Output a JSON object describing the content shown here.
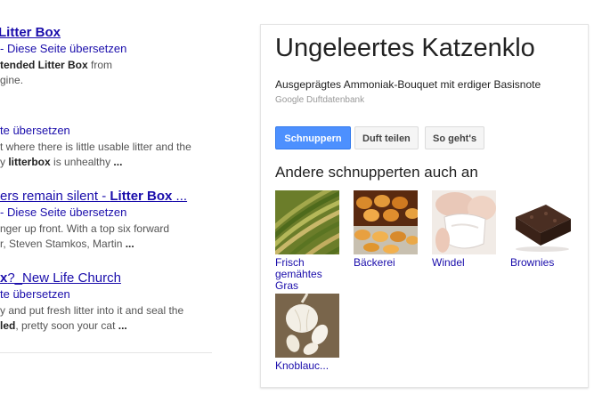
{
  "results": [
    {
      "title": "Litter Box",
      "subtitle": "- Diese Seite übersetzen",
      "snippet1_bold": "tended Litter Box",
      "snippet1_rest": " from",
      "snippet2": "gine."
    },
    {
      "subtitle": "te übersetzen",
      "snippet1": "t where there is little usable litter and the",
      "snippet2_pre": "y ",
      "snippet2_bold": "litterbox",
      "snippet2_rest": " is unhealthy ",
      "snippet2_end": "..."
    },
    {
      "title_pre": "ers remain silent - ",
      "title_bold": "Litter Box",
      "title_end": " ...",
      "subtitle": "- Diese Seite übersetzen",
      "snippet1": "nger up front. With a top six forward",
      "snippet2_pre": "r, Steven Stamkos, Martin ",
      "snippet2_end": "..."
    },
    {
      "title_bold": "x",
      "title_rest": "?_New Life Church",
      "subtitle": "te übersetzen",
      "snippet1": "y and put fresh litter into it and seal the",
      "snippet2_bold": "led",
      "snippet2_rest": ", pretty soon your cat ",
      "snippet2_end": "..."
    }
  ],
  "panel": {
    "title": "Ungeleertes Katzenklo",
    "description": "Ausgeprägtes Ammoniak-Bouquet mit erdiger Basisnote",
    "source": "Google Duftdatenbank",
    "buttons": {
      "primary": "Schnuppern",
      "share": "Duft teilen",
      "how": "So geht's"
    },
    "related_heading": "Andere schnupperten auch an",
    "related": [
      {
        "label": "Frisch gemähtes Gras",
        "icon": "grass-field-image"
      },
      {
        "label": "Bäckerei",
        "icon": "bakery-pastries-image"
      },
      {
        "label": "Windel",
        "icon": "baby-diaper-image"
      },
      {
        "label": "Brownies",
        "icon": "brownies-image"
      },
      {
        "label": "Knoblauc...",
        "icon": "garlic-image"
      }
    ]
  },
  "colors": {
    "link": "#1a0dab",
    "primary_button": "#4d90fe",
    "snippet": "#545454",
    "source": "#999999"
  }
}
